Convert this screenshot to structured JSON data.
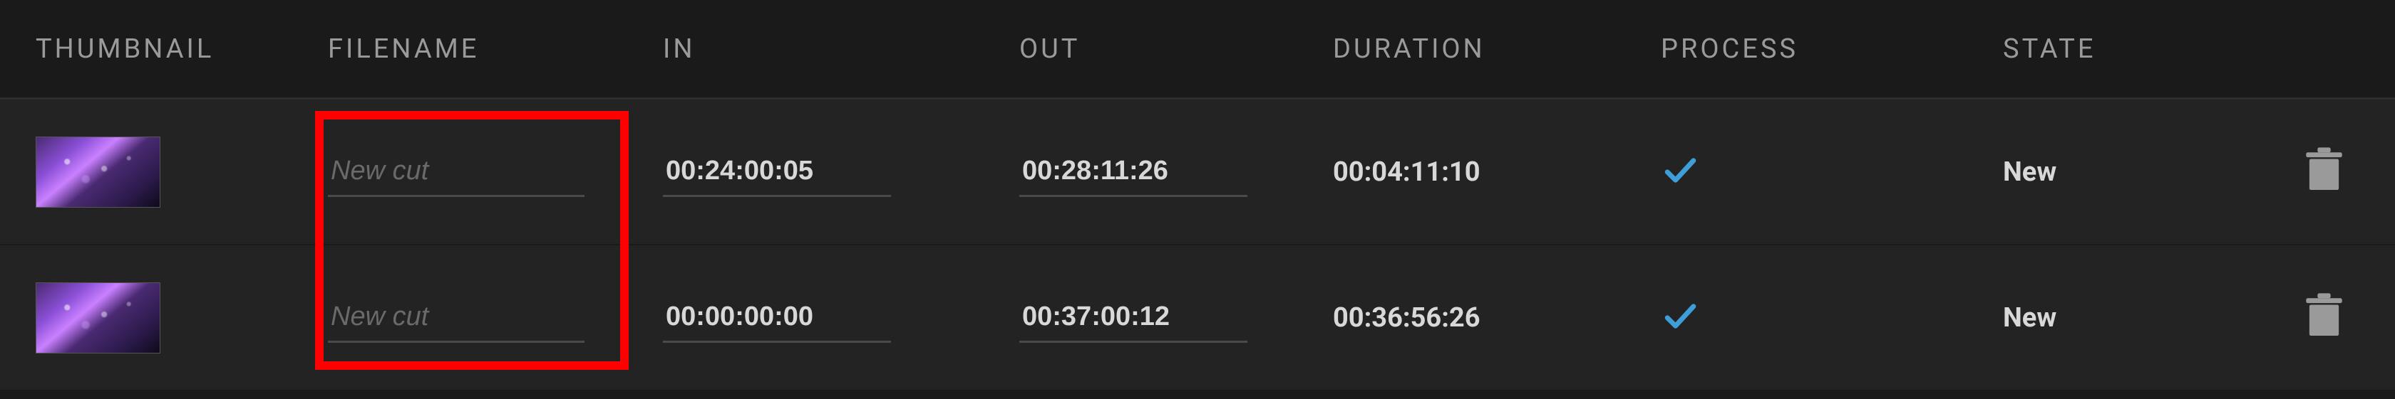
{
  "columns": {
    "thumbnail": "THUMBNAIL",
    "filename": "FILENAME",
    "in": "IN",
    "out": "OUT",
    "duration": "DURATION",
    "process": "PROCESS",
    "state": "STATE"
  },
  "rows": [
    {
      "filename": "",
      "filename_placeholder": "New cut",
      "in": "00:24:00:05",
      "out": "00:28:11:26",
      "duration": "00:04:11:10",
      "process_checked": true,
      "state": "New"
    },
    {
      "filename": "",
      "filename_placeholder": "New cut",
      "in": "00:00:00:00",
      "out": "00:37:00:12",
      "duration": "00:36:56:26",
      "process_checked": true,
      "state": "New"
    }
  ],
  "colors": {
    "process_check": "#3d9ed8",
    "highlight": "#ff0000"
  }
}
